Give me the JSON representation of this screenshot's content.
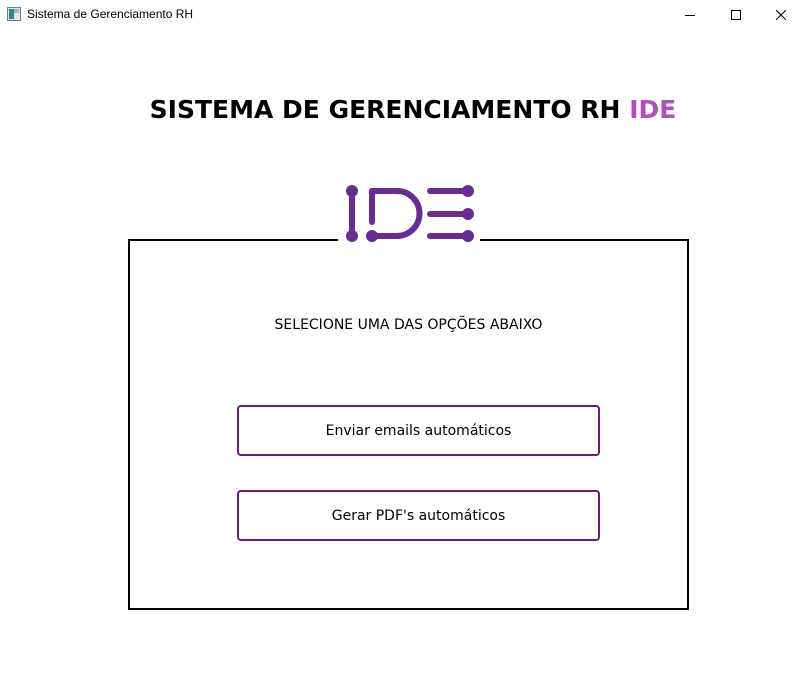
{
  "window": {
    "title": "Sistema de Gerenciamento RH",
    "controls": [
      "minimize",
      "maximize",
      "close"
    ]
  },
  "header": {
    "title_main": "SISTEMA DE GERENCIAMENTO RH",
    "title_accent": "IDE",
    "accent_color": "#b14fbf"
  },
  "logo": {
    "icon": "ide-logo-icon",
    "color": "#6a2c91"
  },
  "panel": {
    "instruction": "SELECIONE UMA DAS OPÇÕES ABAIXO",
    "buttons": [
      {
        "label": "Enviar emails automáticos"
      },
      {
        "label": "Gerar PDF's automáticos"
      }
    ],
    "button_border_color": "#6a1b7f"
  }
}
